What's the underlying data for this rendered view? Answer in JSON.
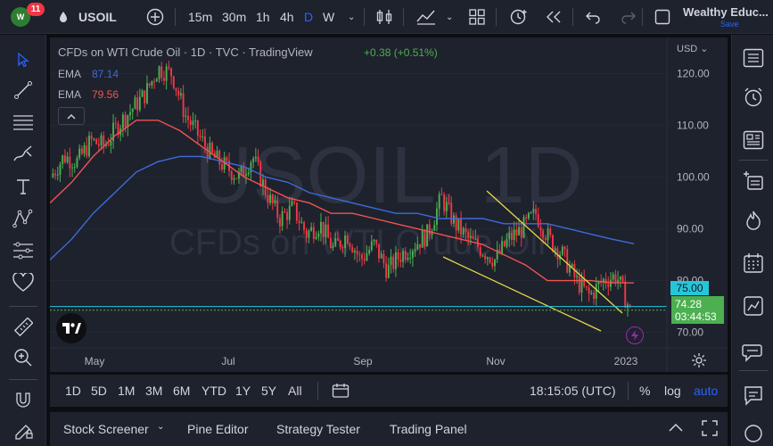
{
  "header": {
    "symbol": "USOIL",
    "notification_count": "11",
    "logo_text": "W",
    "intervals": [
      "15m",
      "30m",
      "1h",
      "4h",
      "D",
      "W"
    ],
    "active_interval": "D",
    "user_name": "Wealthy Educ...",
    "save_label": "Save"
  },
  "legend": {
    "title": "CFDs on WTI Crude Oil · 1D · TVC · TradingView",
    "change": "+0.38 (+0.51%)",
    "ema1_label": "EMA",
    "ema1_value": "87.14",
    "ema2_label": "EMA",
    "ema2_value": "79.56"
  },
  "watermark": {
    "big": "USOIL, 1D",
    "small": "CFDs on WTI Crude Oil"
  },
  "price_axis": {
    "currency": "USD",
    "ticks": [
      "120.00",
      "110.00",
      "100.00",
      "90.00",
      "80.00",
      "70.00"
    ],
    "line_label": "75.00",
    "last_price": "74.28",
    "countdown": "03:44:53"
  },
  "time_axis": {
    "ticks": [
      "May",
      "Jul",
      "Sep",
      "Nov",
      "2023"
    ]
  },
  "bottom_toolbar": {
    "ranges": [
      "1D",
      "5D",
      "1M",
      "3M",
      "6M",
      "YTD",
      "1Y",
      "5Y",
      "All"
    ],
    "clock": "18:15:05 (UTC)",
    "percent": "%",
    "log": "log",
    "auto": "auto"
  },
  "panels": {
    "items": [
      "Stock Screener",
      "Pine Editor",
      "Strategy Tester",
      "Trading Panel"
    ]
  },
  "colors": {
    "ema_fast": "#f05350",
    "ema_slow": "#3d6bd9",
    "up_candle": "#4caf50",
    "down_candle": "#f23645",
    "price_line": "#26c6da",
    "trendline": "#e8d84a",
    "accent": "#2962ff"
  },
  "chart_data": {
    "type": "line",
    "title": "CFDs on WTI Crude Oil · 1D · TVC · TradingView",
    "x_ticks": [
      "May",
      "Jul",
      "Sep",
      "Nov",
      "2023"
    ],
    "ylim": [
      67,
      127
    ],
    "series": [
      {
        "name": "EMA",
        "values": [
          84,
          88,
          93,
          97,
          101,
          103,
          104,
          104,
          103,
          102,
          100,
          99,
          97,
          96,
          95,
          94,
          93,
          93,
          92,
          92,
          92,
          91,
          91,
          91,
          90,
          89,
          88,
          87.14
        ]
      },
      {
        "name": "EMA",
        "values": [
          95,
          99,
          104,
          108,
          111,
          111,
          109,
          106,
          103,
          100,
          98,
          96,
          95,
          93,
          93,
          92,
          91,
          90,
          89,
          88,
          87,
          85,
          83,
          80,
          80,
          80,
          79.6,
          79.56
        ]
      }
    ],
    "price": [
      100,
      104,
      103,
      107,
      106,
      110,
      113,
      116,
      121,
      120,
      112,
      108,
      104,
      102,
      100,
      104,
      97,
      92,
      94,
      89,
      91,
      86,
      89,
      84,
      87,
      82,
      85,
      87,
      89,
      96,
      91,
      88,
      86,
      84,
      88,
      90,
      93,
      88,
      85,
      80,
      77,
      80,
      81,
      74.28
    ],
    "last": 74.28
  }
}
